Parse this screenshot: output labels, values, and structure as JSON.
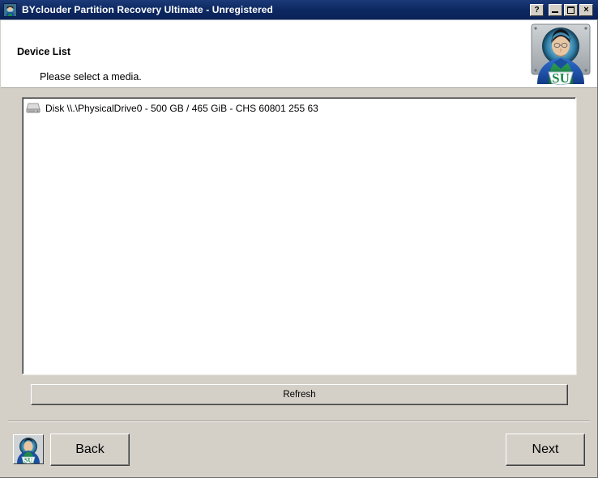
{
  "window": {
    "title": "BYclouder Partition Recovery Ultimate - Unregistered",
    "icon": "app-logo-icon",
    "controls": {
      "help": "?",
      "minimize": "minimize-icon",
      "maximize": "maximize-icon",
      "close": "×"
    }
  },
  "header": {
    "title": "Device List",
    "subtitle": "Please select a media.",
    "logo": "byclouder-superhero-logo"
  },
  "device_list": {
    "items": [
      {
        "icon": "hard-disk-icon",
        "label": "Disk \\\\.\\PhysicalDrive0 - 500 GB / 465 GiB - CHS 60801 255 63"
      }
    ]
  },
  "buttons": {
    "refresh": "Refresh",
    "back": "Back",
    "next": "Next",
    "logo_button": "byclouder-logo-button"
  },
  "colors": {
    "titlebar": "#0c2760",
    "window_face": "#d4d0c8",
    "header_bg": "#ffffff",
    "list_bg": "#ffffff",
    "text": "#000000"
  }
}
